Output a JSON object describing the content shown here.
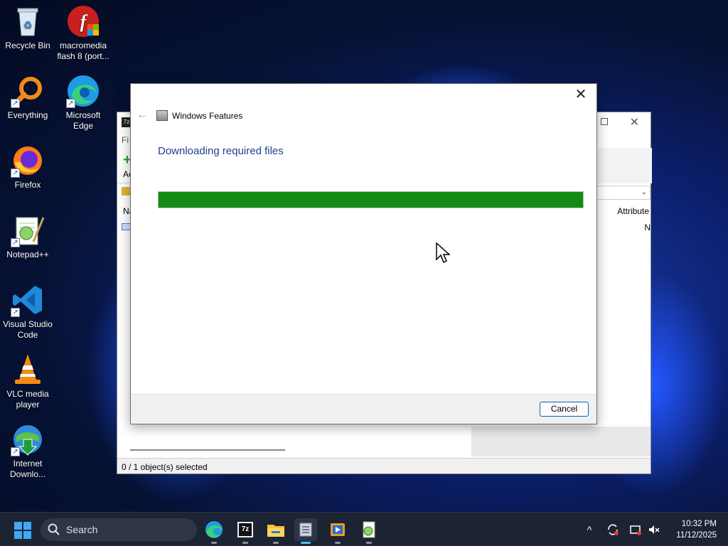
{
  "desktop": {
    "icons": [
      {
        "label": "Recycle Bin"
      },
      {
        "label": "macromedia flash 8 (port..."
      },
      {
        "label": "Everything"
      },
      {
        "label": "Microsoft Edge"
      },
      {
        "label": "Firefox"
      },
      {
        "label": "Notepad++"
      },
      {
        "label": "Visual Studio Code"
      },
      {
        "label": "VLC media player"
      },
      {
        "label": "Internet Downlo..."
      }
    ]
  },
  "zip_window": {
    "menu_partial": "Fi",
    "toolbar_partial": "Ac",
    "column_name_partial": "Na",
    "column_attributes": "Attribute",
    "status": "0 / 1 object(s) selected"
  },
  "dialog": {
    "title": "Windows Features",
    "heading": "Downloading required files",
    "progress_fraction": 1.0,
    "cancel_label": "Cancel",
    "close_glyph": "✕",
    "back_glyph": "←"
  },
  "taskbar": {
    "search_label": "Search",
    "time": "10:32 PM",
    "date": "11/12/2025",
    "tray_chevron": "^"
  },
  "colors": {
    "progress_fill": "#118b11",
    "heading": "#1f3f8f",
    "button_border": "#0067c0",
    "taskbar": "#1c2333"
  }
}
